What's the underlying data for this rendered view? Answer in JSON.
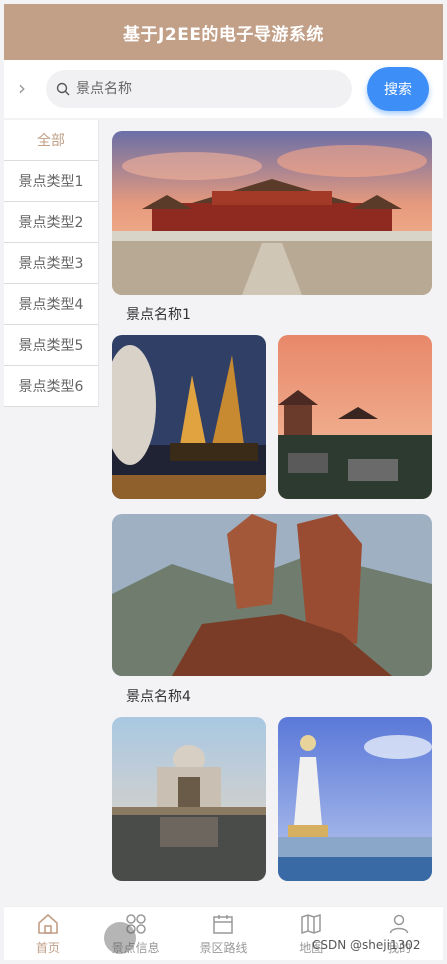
{
  "header": {
    "title": "基于J2EE的电子导游系统"
  },
  "search": {
    "placeholder": "景点名称",
    "button_label": "搜索"
  },
  "sidebar": {
    "items": [
      {
        "label": "全部",
        "active": true
      },
      {
        "label": "景点类型1",
        "active": false
      },
      {
        "label": "景点类型2",
        "active": false
      },
      {
        "label": "景点类型3",
        "active": false
      },
      {
        "label": "景点类型4",
        "active": false
      },
      {
        "label": "景点类型5",
        "active": false
      },
      {
        "label": "景点类型6",
        "active": false
      }
    ]
  },
  "spots": [
    {
      "name": "景点名称1",
      "image": "forbidden-city-photo"
    },
    {
      "name": "",
      "image": "sailing-ship-photo"
    },
    {
      "name": "",
      "image": "pagoda-town-photo"
    },
    {
      "name": "景点名称4",
      "image": "red-rock-peaks-photo"
    },
    {
      "name": "",
      "image": "palace-reflection-photo"
    },
    {
      "name": "",
      "image": "guanyin-statue-photo"
    }
  ],
  "tabbar": {
    "items": [
      {
        "label": "首页",
        "icon": "home-icon",
        "active": true
      },
      {
        "label": "景点信息",
        "icon": "grid-icon",
        "active": false
      },
      {
        "label": "景区路线",
        "icon": "calendar-icon",
        "active": false
      },
      {
        "label": "地图",
        "icon": "map-icon",
        "active": false
      },
      {
        "label": "我的",
        "icon": "user-icon",
        "active": false
      }
    ]
  },
  "watermark": "CSDN @sheji1302",
  "colors": {
    "brand": "#c29f87",
    "accent": "#3d8ef6"
  }
}
